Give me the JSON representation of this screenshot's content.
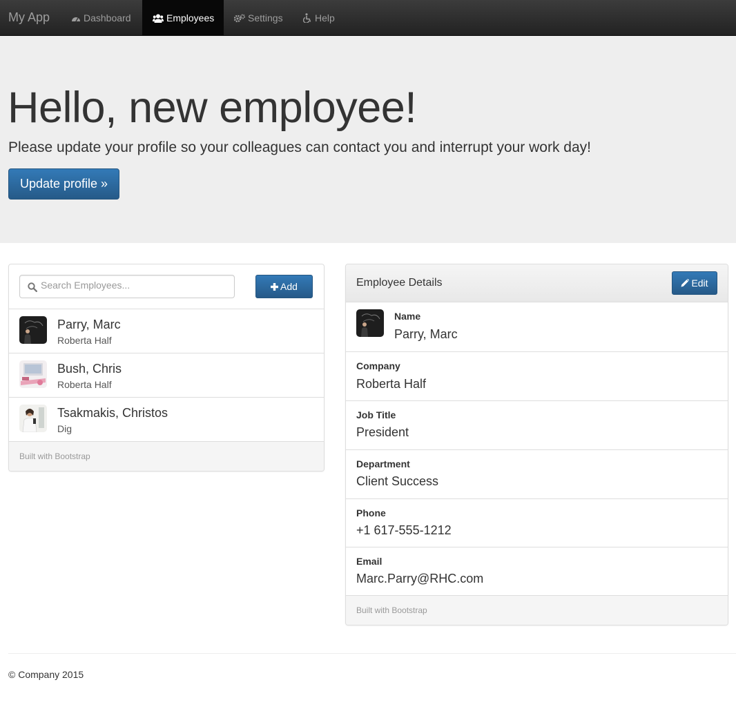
{
  "navbar": {
    "brand": "My App",
    "items": [
      {
        "label": "Dashboard",
        "icon": "dashboard-icon",
        "active": false
      },
      {
        "label": "Employees",
        "icon": "users-icon",
        "active": true
      },
      {
        "label": "Settings",
        "icon": "gears-icon",
        "active": false
      },
      {
        "label": "Help",
        "icon": "wheelchair-icon",
        "active": false
      }
    ]
  },
  "jumbotron": {
    "heading": "Hello, new employee!",
    "lead": "Please update your profile so your colleagues can contact you and interrupt your work day!",
    "button_label": "Update profile »"
  },
  "employee_list": {
    "search_placeholder": "Search Employees...",
    "add_label": "Add",
    "employees": [
      {
        "name": "Parry, Marc",
        "company": "Roberta Half"
      },
      {
        "name": "Bush, Chris",
        "company": "Roberta Half"
      },
      {
        "name": "Tsakmakis, Christos",
        "company": "Dig"
      }
    ],
    "footer": "Built with Bootstrap"
  },
  "employee_details": {
    "title": "Employee Details",
    "edit_label": "Edit",
    "fields": [
      {
        "label": "Name",
        "value": "Parry, Marc"
      },
      {
        "label": "Company",
        "value": "Roberta Half"
      },
      {
        "label": "Job Title",
        "value": "President"
      },
      {
        "label": "Department",
        "value": "Client Success"
      },
      {
        "label": "Phone",
        "value": "+1 617-555-1212"
      },
      {
        "label": "Email",
        "value": "Marc.Parry@RHC.com"
      }
    ],
    "footer": "Built with Bootstrap"
  },
  "footer": {
    "copyright": "© Company 2015"
  },
  "colors": {
    "primary": "#337ab7",
    "navbar": "#222222",
    "jumbotron_bg": "#eeeeee"
  }
}
